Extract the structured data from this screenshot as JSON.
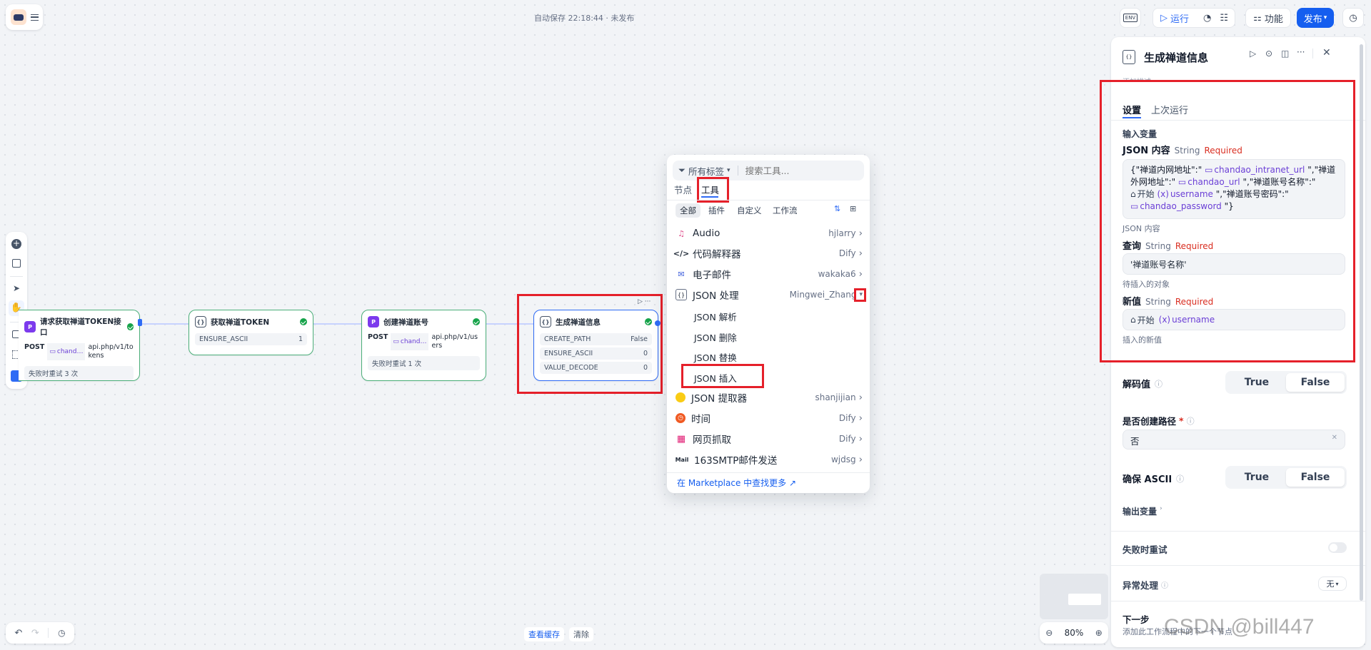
{
  "header": {
    "autosave": "自动保存 22:18:44 · 未发布",
    "env_label": "ENV",
    "run_label": "运行",
    "features_label": "功能",
    "publish_label": "发布"
  },
  "nodes": [
    {
      "title": "请求获取禅道TOKEN接口",
      "method": "POST",
      "var": "chand…",
      "url": "api.php/v1/tokens",
      "retry": "失败时重试 3 次"
    },
    {
      "title": "获取禅道TOKEN",
      "rows": [
        {
          "k": "ENSURE_ASCII",
          "v": "1"
        }
      ]
    },
    {
      "title": "创建禅道账号",
      "method": "POST",
      "var": "chand…",
      "url": "api.php/v1/users",
      "retry": "失败时重试 1 次"
    },
    {
      "title": "生成禅道信息",
      "rows": [
        {
          "k": "CREATE_PATH",
          "v": "False"
        },
        {
          "k": "ENSURE_ASCII",
          "v": "0"
        },
        {
          "k": "VALUE_DECODE",
          "v": "0"
        }
      ]
    }
  ],
  "picker": {
    "tag_filter": "所有标签",
    "search_placeholder": "搜索工具...",
    "tabs": [
      "节点",
      "工具"
    ],
    "categories": [
      "全部",
      "插件",
      "自定义",
      "工作流"
    ],
    "tools": [
      {
        "name": "Audio",
        "author": "hjlarry"
      },
      {
        "name": "代码解释器",
        "author": "Dify"
      },
      {
        "name": "电子邮件",
        "author": "wakaka6"
      },
      {
        "name": "JSON 处理",
        "author": "Mingwei_Zhang"
      }
    ],
    "sub_tools": [
      "JSON 解析",
      "JSON 删除",
      "JSON 替换",
      "JSON 插入"
    ],
    "tools2": [
      {
        "name": "JSON 提取器",
        "author": "shanjijian"
      },
      {
        "name": "时间",
        "author": "Dify"
      },
      {
        "name": "网页抓取",
        "author": "Dify"
      },
      {
        "name": "163SMTP邮件发送",
        "author": "wjdsg"
      }
    ],
    "mail_label": "Mail",
    "marketplace": "在 Marketplace 中查找更多 ↗"
  },
  "panel": {
    "title": "生成禅道信息",
    "desc_placeholder": "添加描述...",
    "tabs": [
      "设置",
      "上次运行"
    ],
    "input_vars": "输入变量",
    "json_content": {
      "label": "JSON 内容",
      "type": "String",
      "required": "Required",
      "t1": "{\"禅道内网地址\":\"",
      "v1": "chandao_intranet_url",
      "t2": "\",\"禅道外网地址\":\"",
      "v2": "chandao_url",
      "t3": "\",\"禅道账号名称\":\"",
      "start": "开始",
      "v3": "username",
      "t4": "\",\"禅道账号密码\":\"",
      "v4": "chandao_password",
      "t5": "\"}",
      "hint": "JSON 内容"
    },
    "query": {
      "label": "查询",
      "type": "String",
      "required": "Required",
      "value": "'禅道账号名称'",
      "hint": "待插入的对象"
    },
    "new_value": {
      "label": "新值",
      "type": "String",
      "required": "Required",
      "start": "开始",
      "var": "username",
      "hint": "插入的新值"
    },
    "decode": {
      "label": "解码值",
      "options": [
        "True",
        "False"
      ],
      "selected": "False"
    },
    "create_path": {
      "label": "是否创建路径",
      "star": "*",
      "value": "否"
    },
    "ensure_ascii": {
      "label": "确保 ASCII",
      "options": [
        "True",
        "False"
      ],
      "selected": "False"
    },
    "output_vars": "输出变量",
    "retry": "失败时重试",
    "error_handling": "异常处理",
    "error_value": "无",
    "next_step": "下一步",
    "next_hint": "添加此工作流程中的下一个节点"
  },
  "bottom": {
    "view_cache": "查看缓存",
    "clear": "清除",
    "zoom": "80%"
  },
  "watermark": "CSDN @bill447"
}
